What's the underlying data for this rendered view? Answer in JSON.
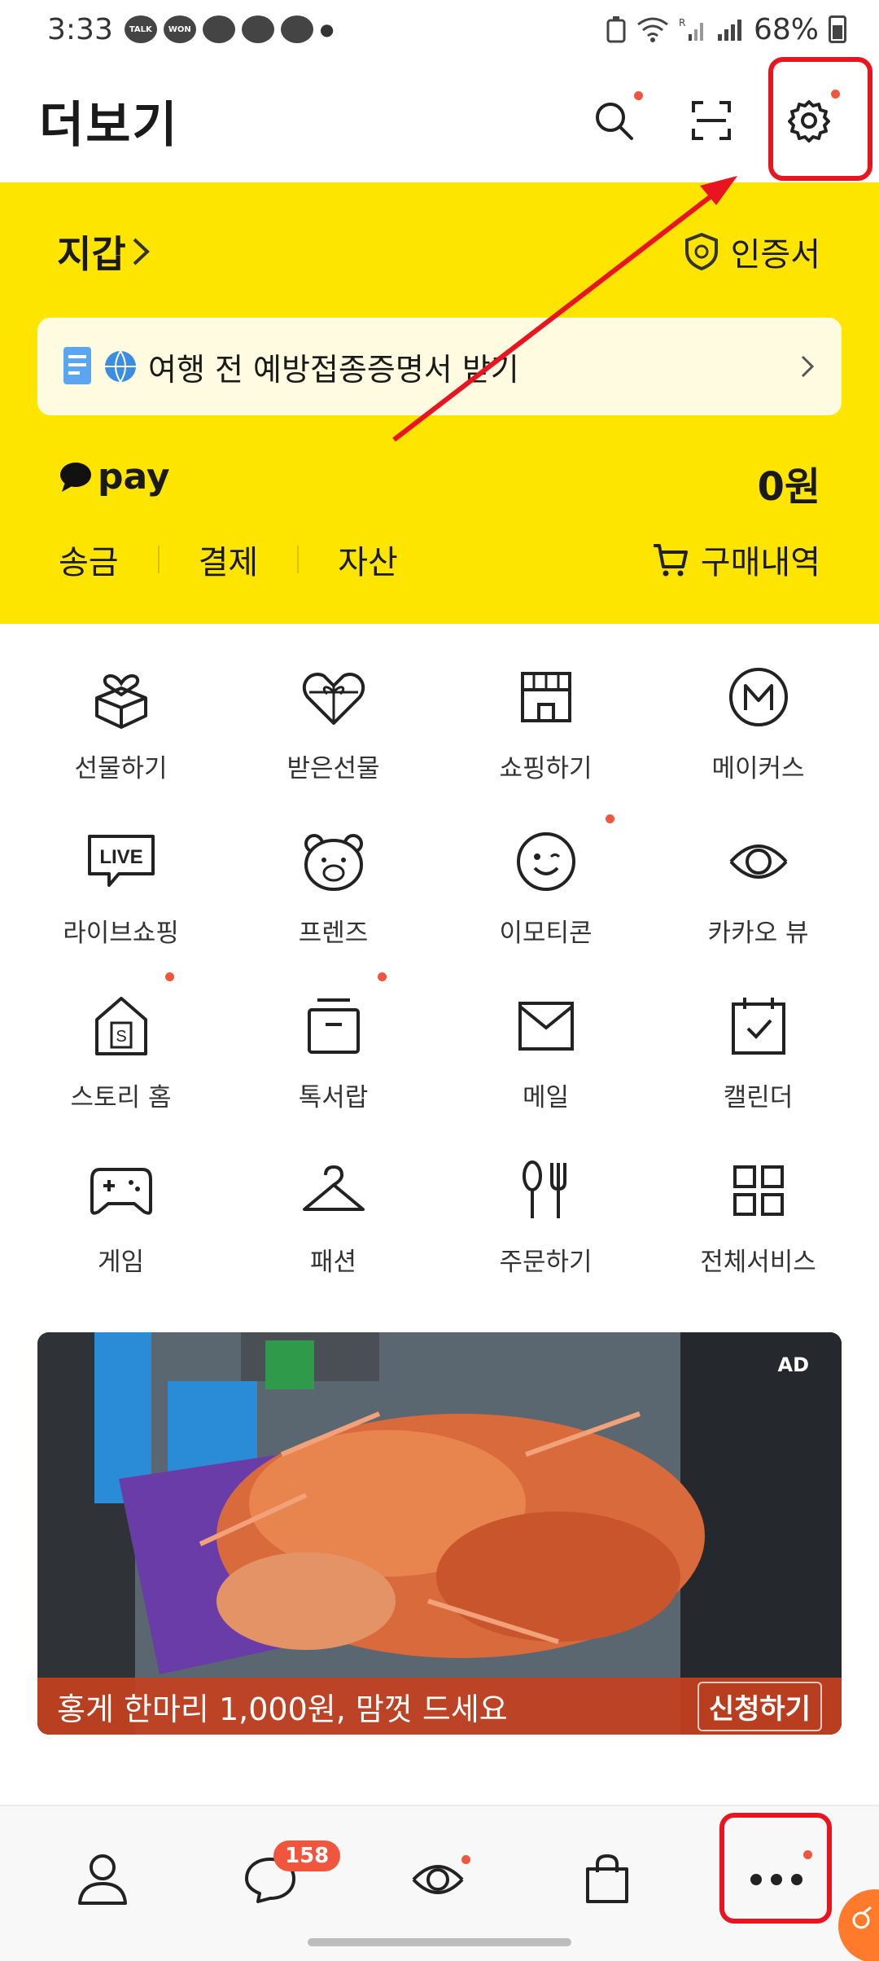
{
  "status_bar": {
    "time": "3:33",
    "notif_talk": "TALK",
    "notif_won": "WON",
    "battery": "68%"
  },
  "header": {
    "title": "더보기"
  },
  "wallet": {
    "title": "지갑",
    "cert_label": "인증서",
    "notice_text": "여행 전 예방접종증명서 받기",
    "pay_label": "pay",
    "balance": "0원",
    "nav": [
      "송금",
      "결제",
      "자산"
    ],
    "purchase_label": "구매내역"
  },
  "services": [
    {
      "label": "선물하기",
      "icon": "gift-box-icon"
    },
    {
      "label": "받은선물",
      "icon": "heart-gift-icon"
    },
    {
      "label": "쇼핑하기",
      "icon": "store-icon"
    },
    {
      "label": "메이커스",
      "icon": "makers-m-icon"
    },
    {
      "label": "라이브쇼핑",
      "icon": "live-icon"
    },
    {
      "label": "프렌즈",
      "icon": "bear-face-icon"
    },
    {
      "label": "이모티콘",
      "icon": "smile-icon"
    },
    {
      "label": "카카오 뷰",
      "icon": "view-eye-icon"
    },
    {
      "label": "스토리 홈",
      "icon": "story-home-icon"
    },
    {
      "label": "톡서랍",
      "icon": "drawer-icon"
    },
    {
      "label": "메일",
      "icon": "mail-icon"
    },
    {
      "label": "캘린더",
      "icon": "calendar-icon"
    },
    {
      "label": "게임",
      "icon": "gamepad-icon"
    },
    {
      "label": "패션",
      "icon": "hanger-icon"
    },
    {
      "label": "주문하기",
      "icon": "fork-knife-icon"
    },
    {
      "label": "전체서비스",
      "icon": "grid-icon"
    }
  ],
  "ad": {
    "label": "AD",
    "headline": "홍게 한마리 1,000원, 맘껏 드세요",
    "cta": "신청하기"
  },
  "bottom_nav": {
    "chat_badge": "158"
  },
  "colors": {
    "brand_yellow": "#fee500",
    "notification_dot": "#f0553d",
    "annotation_red": "#e8141f"
  }
}
